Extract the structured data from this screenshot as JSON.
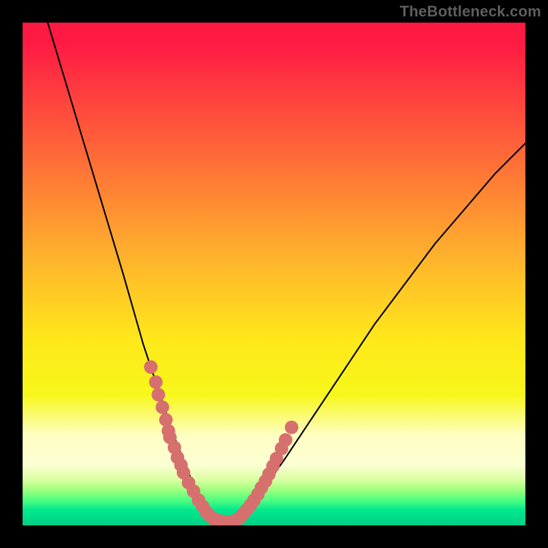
{
  "watermark": "TheBottleneck.com",
  "chart_data": {
    "type": "line",
    "title": "",
    "xlabel": "",
    "ylabel": "",
    "xlim": [
      0,
      100
    ],
    "ylim": [
      0,
      100
    ],
    "grid": false,
    "legend": false,
    "series": [
      {
        "name": "bottleneck-curve",
        "kind": "line",
        "x": [
          5,
          8,
          11,
          14,
          17,
          20,
          22,
          24,
          26,
          28,
          30,
          32,
          34,
          35.5,
          37,
          38.5,
          40,
          42,
          44,
          47,
          52,
          58,
          64,
          70,
          76,
          82,
          88,
          94,
          100
        ],
        "y": [
          100,
          90,
          80,
          70,
          60,
          50,
          43,
          36,
          30,
          24,
          18,
          13,
          8,
          5,
          2.5,
          1,
          0.5,
          0.5,
          2,
          6,
          13,
          22,
          31,
          40,
          48,
          56,
          63,
          70,
          76
        ]
      },
      {
        "name": "left-cluster",
        "kind": "scatter",
        "x": [
          25.5,
          26.5,
          27.0,
          27.8,
          28.5,
          29.0,
          29.3,
          30.2,
          30.8,
          31.5,
          32.0,
          33.0,
          34.0,
          35.0,
          35.8,
          36.5,
          37.2,
          38.0,
          38.8
        ],
        "y": [
          31.5,
          28.5,
          26.0,
          23.5,
          21.0,
          18.8,
          17.5,
          15.5,
          13.5,
          12.0,
          10.5,
          8.5,
          6.8,
          5.0,
          3.8,
          2.7,
          1.9,
          1.3,
          1.0
        ]
      },
      {
        "name": "valley-cluster",
        "kind": "scatter",
        "x": [
          39.5,
          40.3,
          41.0,
          41.8,
          42.5
        ],
        "y": [
          0.8,
          0.7,
          0.7,
          0.8,
          1.0
        ]
      },
      {
        "name": "right-cluster",
        "kind": "scatter",
        "x": [
          43.2,
          43.8,
          44.5,
          45.3,
          46.0,
          46.8,
          47.5,
          48.3,
          49.0,
          49.8,
          50.5,
          51.5,
          52.3,
          53.5
        ],
        "y": [
          1.5,
          2.2,
          3.0,
          4.0,
          5.0,
          6.2,
          7.5,
          8.8,
          10.2,
          11.8,
          13.3,
          15.3,
          17.0,
          19.5
        ]
      }
    ],
    "annotations": [],
    "colors": {
      "curve": "#000000",
      "dots": "#d6706e",
      "bg_top": "#ff1a44",
      "bg_bottom": "#00d086"
    }
  }
}
